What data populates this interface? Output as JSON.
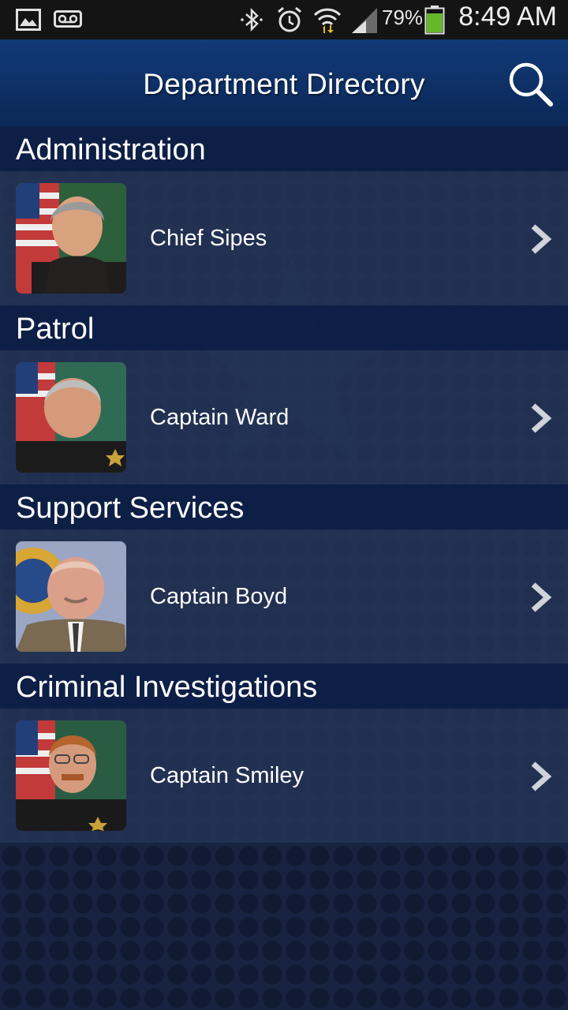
{
  "status_bar": {
    "battery_percent": "79%",
    "time": "8:49 AM",
    "icons": [
      "image-icon",
      "voicemail-icon",
      "bluetooth-icon",
      "alarm-icon",
      "wifi-icon",
      "signal-icon",
      "battery-icon"
    ]
  },
  "header": {
    "title": "Department Directory",
    "search_icon": "search-icon"
  },
  "sections": [
    {
      "title": "Administration",
      "contact": {
        "name": "Chief Sipes",
        "photo": "photo-chief-sipes"
      }
    },
    {
      "title": "Patrol",
      "contact": {
        "name": "Captain Ward",
        "photo": "photo-captain-ward"
      }
    },
    {
      "title": "Support Services",
      "contact": {
        "name": "Captain Boyd",
        "photo": "photo-captain-boyd"
      }
    },
    {
      "title": "Criminal Investigations",
      "contact": {
        "name": "Captain Smiley",
        "photo": "photo-captain-smiley"
      }
    }
  ],
  "colors": {
    "header": "#123a78",
    "section_header": "#0e2048",
    "row": "#263658",
    "background": "#16223f"
  }
}
